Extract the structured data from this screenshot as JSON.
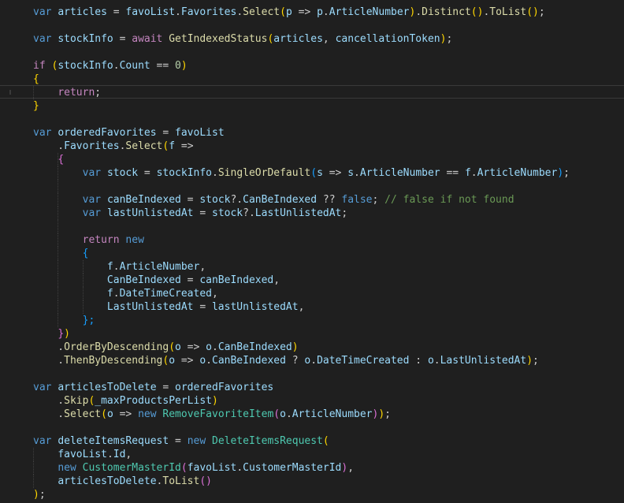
{
  "editor": {
    "lines": [
      [
        {
          "t": "var",
          "c": "kw"
        },
        {
          "t": " "
        },
        {
          "t": "articles",
          "c": "v"
        },
        {
          "t": " = "
        },
        {
          "t": "favoList",
          "c": "v"
        },
        {
          "t": "."
        },
        {
          "t": "Favorites",
          "c": "v"
        },
        {
          "t": "."
        },
        {
          "t": "Select",
          "c": "fn"
        },
        {
          "t": "(",
          "c": "b1"
        },
        {
          "t": "p",
          "c": "v"
        },
        {
          "t": " => "
        },
        {
          "t": "p",
          "c": "v"
        },
        {
          "t": "."
        },
        {
          "t": "ArticleNumber",
          "c": "v"
        },
        {
          "t": ")",
          "c": "b1"
        },
        {
          "t": "."
        },
        {
          "t": "Distinct",
          "c": "fn"
        },
        {
          "t": "()",
          "c": "b1"
        },
        {
          "t": "."
        },
        {
          "t": "ToList",
          "c": "fn"
        },
        {
          "t": "()",
          "c": "b1"
        },
        {
          "t": ";"
        }
      ],
      [],
      [
        {
          "t": "var",
          "c": "kw"
        },
        {
          "t": " "
        },
        {
          "t": "stockInfo",
          "c": "v"
        },
        {
          "t": " = "
        },
        {
          "t": "await",
          "c": "ctl"
        },
        {
          "t": " "
        },
        {
          "t": "GetIndexedStatus",
          "c": "fn"
        },
        {
          "t": "(",
          "c": "b1"
        },
        {
          "t": "articles",
          "c": "v"
        },
        {
          "t": ", "
        },
        {
          "t": "cancellationToken",
          "c": "v"
        },
        {
          "t": ")",
          "c": "b1"
        },
        {
          "t": ";"
        }
      ],
      [],
      [
        {
          "t": "if",
          "c": "ctl"
        },
        {
          "t": " "
        },
        {
          "t": "(",
          "c": "b1"
        },
        {
          "t": "stockInfo",
          "c": "v"
        },
        {
          "t": "."
        },
        {
          "t": "Count",
          "c": "v"
        },
        {
          "t": " == "
        },
        {
          "t": "0",
          "c": "num"
        },
        {
          "t": ")",
          "c": "b1"
        }
      ],
      [
        {
          "t": "{",
          "c": "b1"
        }
      ],
      [
        {
          "t": "    "
        },
        {
          "t": "return",
          "c": "ctl"
        },
        {
          "t": ";"
        }
      ],
      [
        {
          "t": "}",
          "c": "b1"
        }
      ],
      [],
      [
        {
          "t": "var",
          "c": "kw"
        },
        {
          "t": " "
        },
        {
          "t": "orderedFavorites",
          "c": "v"
        },
        {
          "t": " = "
        },
        {
          "t": "favoList",
          "c": "v"
        }
      ],
      [
        {
          "t": "    ."
        },
        {
          "t": "Favorites",
          "c": "v"
        },
        {
          "t": "."
        },
        {
          "t": "Select",
          "c": "fn"
        },
        {
          "t": "(",
          "c": "b1"
        },
        {
          "t": "f",
          "c": "v"
        },
        {
          "t": " =>"
        }
      ],
      [
        {
          "t": "    "
        },
        {
          "t": "{",
          "c": "b2"
        }
      ],
      [
        {
          "t": "        "
        },
        {
          "t": "var",
          "c": "kw"
        },
        {
          "t": " "
        },
        {
          "t": "stock",
          "c": "v"
        },
        {
          "t": " = "
        },
        {
          "t": "stockInfo",
          "c": "v"
        },
        {
          "t": "."
        },
        {
          "t": "SingleOrDefault",
          "c": "fn"
        },
        {
          "t": "(",
          "c": "b3"
        },
        {
          "t": "s",
          "c": "v"
        },
        {
          "t": " => "
        },
        {
          "t": "s",
          "c": "v"
        },
        {
          "t": "."
        },
        {
          "t": "ArticleNumber",
          "c": "v"
        },
        {
          "t": " == "
        },
        {
          "t": "f",
          "c": "v"
        },
        {
          "t": "."
        },
        {
          "t": "ArticleNumber",
          "c": "v"
        },
        {
          "t": ")",
          "c": "b3"
        },
        {
          "t": ";"
        }
      ],
      [],
      [
        {
          "t": "        "
        },
        {
          "t": "var",
          "c": "kw"
        },
        {
          "t": " "
        },
        {
          "t": "canBeIndexed",
          "c": "v"
        },
        {
          "t": " = "
        },
        {
          "t": "stock",
          "c": "v"
        },
        {
          "t": "?."
        },
        {
          "t": "CanBeIndexed",
          "c": "v"
        },
        {
          "t": " ?? "
        },
        {
          "t": "false",
          "c": "kw"
        },
        {
          "t": "; "
        },
        {
          "t": "// false if not found",
          "c": "cm"
        }
      ],
      [
        {
          "t": "        "
        },
        {
          "t": "var",
          "c": "kw"
        },
        {
          "t": " "
        },
        {
          "t": "lastUnlistedAt",
          "c": "v"
        },
        {
          "t": " = "
        },
        {
          "t": "stock",
          "c": "v"
        },
        {
          "t": "?."
        },
        {
          "t": "LastUnlistedAt",
          "c": "v"
        },
        {
          "t": ";"
        }
      ],
      [],
      [
        {
          "t": "        "
        },
        {
          "t": "return",
          "c": "ctl"
        },
        {
          "t": " "
        },
        {
          "t": "new",
          "c": "kw"
        }
      ],
      [
        {
          "t": "        "
        },
        {
          "t": "{",
          "c": "b3"
        }
      ],
      [
        {
          "t": "            "
        },
        {
          "t": "f",
          "c": "v"
        },
        {
          "t": "."
        },
        {
          "t": "ArticleNumber",
          "c": "v"
        },
        {
          "t": ","
        }
      ],
      [
        {
          "t": "            "
        },
        {
          "t": "CanBeIndexed",
          "c": "v"
        },
        {
          "t": " = "
        },
        {
          "t": "canBeIndexed",
          "c": "v"
        },
        {
          "t": ","
        }
      ],
      [
        {
          "t": "            "
        },
        {
          "t": "f",
          "c": "v"
        },
        {
          "t": "."
        },
        {
          "t": "DateTimeCreated",
          "c": "v"
        },
        {
          "t": ","
        }
      ],
      [
        {
          "t": "            "
        },
        {
          "t": "LastUnlistedAt",
          "c": "v"
        },
        {
          "t": " = "
        },
        {
          "t": "lastUnlistedAt",
          "c": "v"
        },
        {
          "t": ","
        }
      ],
      [
        {
          "t": "        "
        },
        {
          "t": "};",
          "c": "b3"
        }
      ],
      [
        {
          "t": "    "
        },
        {
          "t": "}",
          "c": "b2"
        },
        {
          "t": ")",
          "c": "b1"
        }
      ],
      [
        {
          "t": "    ."
        },
        {
          "t": "OrderByDescending",
          "c": "fn"
        },
        {
          "t": "(",
          "c": "b1"
        },
        {
          "t": "o",
          "c": "v"
        },
        {
          "t": " => "
        },
        {
          "t": "o",
          "c": "v"
        },
        {
          "t": "."
        },
        {
          "t": "CanBeIndexed",
          "c": "v"
        },
        {
          "t": ")",
          "c": "b1"
        }
      ],
      [
        {
          "t": "    ."
        },
        {
          "t": "ThenByDescending",
          "c": "fn"
        },
        {
          "t": "(",
          "c": "b1"
        },
        {
          "t": "o",
          "c": "v"
        },
        {
          "t": " => "
        },
        {
          "t": "o",
          "c": "v"
        },
        {
          "t": "."
        },
        {
          "t": "CanBeIndexed",
          "c": "v"
        },
        {
          "t": " ? "
        },
        {
          "t": "o",
          "c": "v"
        },
        {
          "t": "."
        },
        {
          "t": "DateTimeCreated",
          "c": "v"
        },
        {
          "t": " : "
        },
        {
          "t": "o",
          "c": "v"
        },
        {
          "t": "."
        },
        {
          "t": "LastUnlistedAt",
          "c": "v"
        },
        {
          "t": ")",
          "c": "b1"
        },
        {
          "t": ";"
        }
      ],
      [],
      [
        {
          "t": "var",
          "c": "kw"
        },
        {
          "t": " "
        },
        {
          "t": "articlesToDelete",
          "c": "v"
        },
        {
          "t": " = "
        },
        {
          "t": "orderedFavorites",
          "c": "v"
        }
      ],
      [
        {
          "t": "    ."
        },
        {
          "t": "Skip",
          "c": "fn"
        },
        {
          "t": "(",
          "c": "b1"
        },
        {
          "t": "_maxProductsPerList",
          "c": "v"
        },
        {
          "t": ")",
          "c": "b1"
        }
      ],
      [
        {
          "t": "    ."
        },
        {
          "t": "Select",
          "c": "fn"
        },
        {
          "t": "(",
          "c": "b1"
        },
        {
          "t": "o",
          "c": "v"
        },
        {
          "t": " => "
        },
        {
          "t": "new",
          "c": "kw"
        },
        {
          "t": " "
        },
        {
          "t": "RemoveFavoriteItem",
          "c": "ty"
        },
        {
          "t": "(",
          "c": "b2"
        },
        {
          "t": "o",
          "c": "v"
        },
        {
          "t": "."
        },
        {
          "t": "ArticleNumber",
          "c": "v"
        },
        {
          "t": ")",
          "c": "b2"
        },
        {
          "t": ")",
          "c": "b1"
        },
        {
          "t": ";"
        }
      ],
      [],
      [
        {
          "t": "var",
          "c": "kw"
        },
        {
          "t": " "
        },
        {
          "t": "deleteItemsRequest",
          "c": "v"
        },
        {
          "t": " = "
        },
        {
          "t": "new",
          "c": "kw"
        },
        {
          "t": " "
        },
        {
          "t": "DeleteItemsRequest",
          "c": "ty"
        },
        {
          "t": "(",
          "c": "b1"
        }
      ],
      [
        {
          "t": "    "
        },
        {
          "t": "favoList",
          "c": "v"
        },
        {
          "t": "."
        },
        {
          "t": "Id",
          "c": "v"
        },
        {
          "t": ","
        }
      ],
      [
        {
          "t": "    "
        },
        {
          "t": "new",
          "c": "kw"
        },
        {
          "t": " "
        },
        {
          "t": "CustomerMasterId",
          "c": "ty"
        },
        {
          "t": "(",
          "c": "b2"
        },
        {
          "t": "favoList",
          "c": "v"
        },
        {
          "t": "."
        },
        {
          "t": "CustomerMasterId",
          "c": "v"
        },
        {
          "t": ")",
          "c": "b2"
        },
        {
          "t": ","
        }
      ],
      [
        {
          "t": "    "
        },
        {
          "t": "articlesToDelete",
          "c": "v"
        },
        {
          "t": "."
        },
        {
          "t": "ToList",
          "c": "fn"
        },
        {
          "t": "()",
          "c": "b2"
        }
      ],
      [
        {
          "t": ")",
          "c": "b1"
        },
        {
          "t": ";"
        }
      ]
    ]
  }
}
